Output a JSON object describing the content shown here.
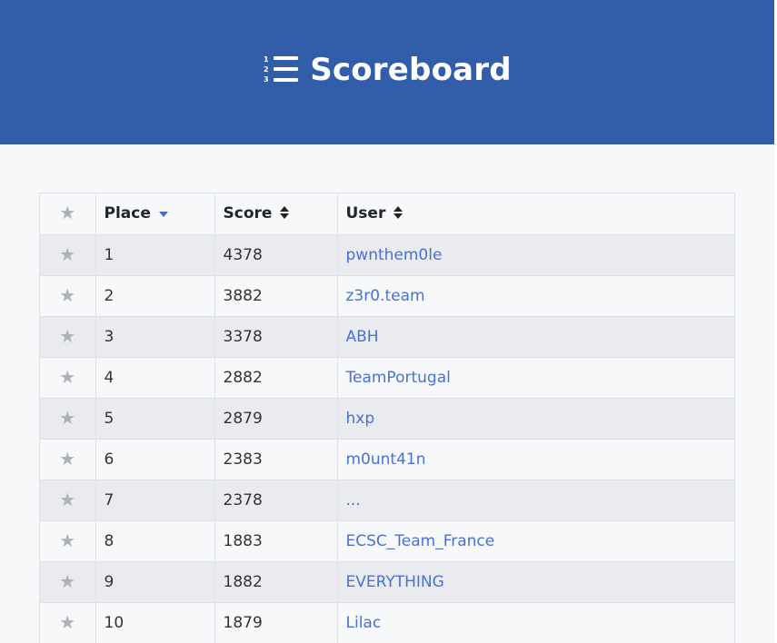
{
  "header": {
    "title": "Scoreboard",
    "icon": "list-ol-icon",
    "background_color": "#325da8"
  },
  "table": {
    "columns": [
      {
        "key": "star",
        "label": "",
        "icon": "star-icon"
      },
      {
        "key": "place",
        "label": "Place",
        "sort": "descending-active"
      },
      {
        "key": "score",
        "label": "Score",
        "sort": "sortable"
      },
      {
        "key": "user",
        "label": "User",
        "sort": "sortable"
      }
    ],
    "rows": [
      {
        "place": "1",
        "score": "4378",
        "user": "pwnthem0le"
      },
      {
        "place": "2",
        "score": "3882",
        "user": "z3r0.team"
      },
      {
        "place": "3",
        "score": "3378",
        "user": "ABH"
      },
      {
        "place": "4",
        "score": "2882",
        "user": "TeamPortugal"
      },
      {
        "place": "5",
        "score": "2879",
        "user": "hxp"
      },
      {
        "place": "6",
        "score": "2383",
        "user": "m0unt41n"
      },
      {
        "place": "7",
        "score": "2378",
        "user": "..."
      },
      {
        "place": "8",
        "score": "1883",
        "user": "ECSC_Team_France"
      },
      {
        "place": "9",
        "score": "1882",
        "user": "EVERYTHING"
      },
      {
        "place": "10",
        "score": "1879",
        "user": "Lilac"
      }
    ],
    "link_color": "#4a70d6",
    "star_color": "#adb0b4"
  }
}
